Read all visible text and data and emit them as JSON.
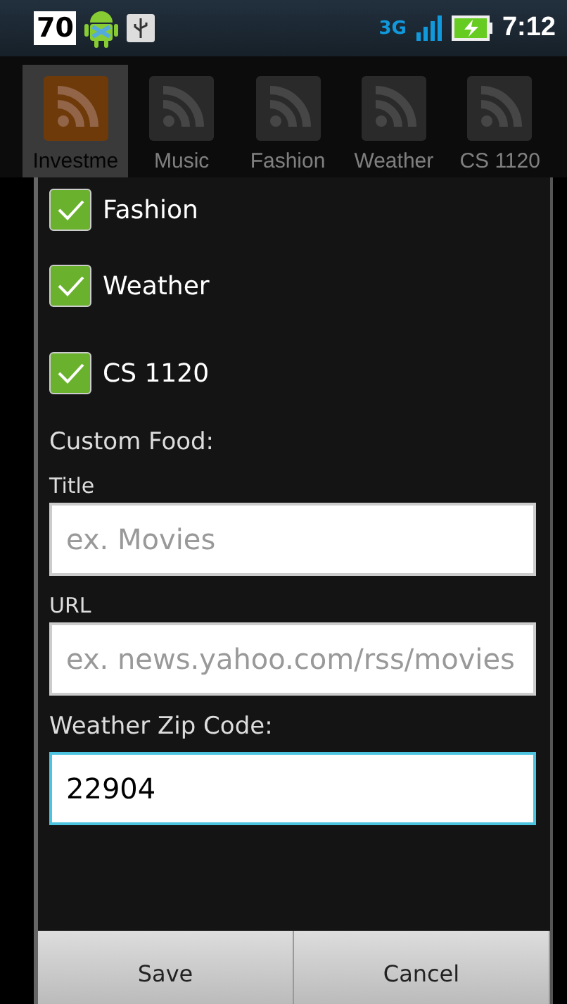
{
  "status_bar": {
    "notification_count": "70",
    "network": "3G",
    "time": "7:12"
  },
  "tabs": [
    {
      "label": "Investme",
      "selected": true
    },
    {
      "label": "Music",
      "selected": false
    },
    {
      "label": "Fashion",
      "selected": false
    },
    {
      "label": "Weather",
      "selected": false
    },
    {
      "label": "CS 1120",
      "selected": false
    }
  ],
  "dialog": {
    "feeds": [
      {
        "label": "Fashion",
        "checked": true
      },
      {
        "label": "Weather",
        "checked": true
      },
      {
        "label": "CS 1120",
        "checked": true
      }
    ],
    "custom_heading": "Custom Food:",
    "fields": [
      {
        "label": "Title",
        "placeholder": "ex. Movies",
        "focused": false
      },
      {
        "label": "URL",
        "placeholder": "ex. news.yahoo.com/rss/movies",
        "focused": false
      },
      {
        "label": "Weather Zip Code:",
        "value": "22904",
        "focused": true
      }
    ],
    "buttons": [
      "Save",
      "Cancel"
    ]
  }
}
